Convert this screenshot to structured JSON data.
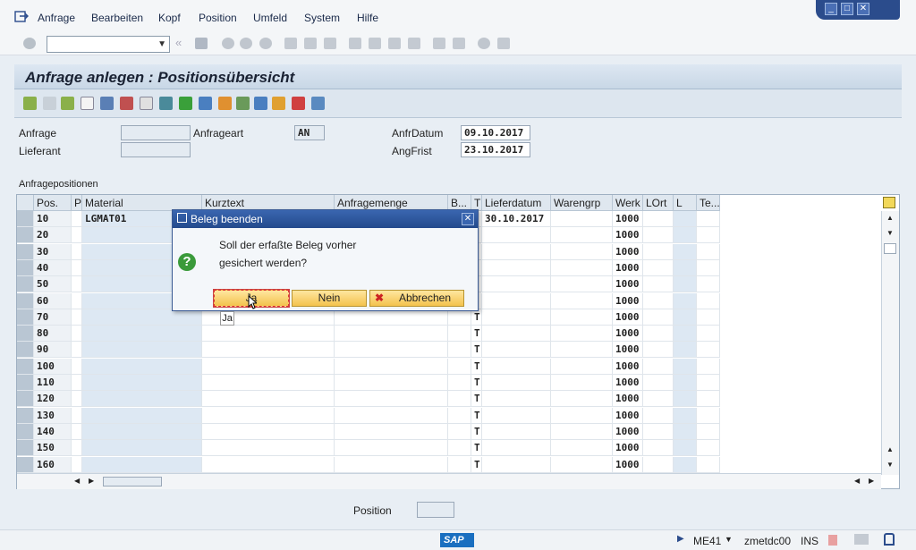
{
  "menu": [
    "Anfrage",
    "Bearbeiten",
    "Kopf",
    "Position",
    "Umfeld",
    "System",
    "Hilfe"
  ],
  "menu_accel": [
    "A",
    "B",
    "K",
    "P",
    "U",
    "S",
    "H"
  ],
  "window_controls": [
    "minimize-icon",
    "maximize-icon",
    "close-icon"
  ],
  "page_title": "Anfrage anlegen : Positionsübersicht",
  "header": {
    "anfrage_label": "Anfrage",
    "anfrage_value": "",
    "lieferant_label": "Lieferant",
    "lieferant_value": "",
    "anfrageart_label": "Anfrageart",
    "anfrageart_value": "AN",
    "anfrdatum_label": "AnfrDatum",
    "anfrdatum_value": "09.10.2017",
    "angfrist_label": "AngFrist",
    "angfrist_value": "23.10.2017"
  },
  "table_title": "Anfragepositionen",
  "columns": [
    "Pos.",
    "P",
    "Material",
    "Kurztext",
    "Anfragemenge",
    "B...",
    "T",
    "Lieferdatum",
    "Warengrp",
    "Werk",
    "LOrt",
    "L",
    "Te..."
  ],
  "rows": [
    {
      "pos": "10",
      "material": "LGMAT01",
      "t": "",
      "lieferdatum": "30.10.2017",
      "werk": "1000"
    },
    {
      "pos": "20",
      "material": "",
      "t": "",
      "lieferdatum": "",
      "werk": "1000"
    },
    {
      "pos": "30",
      "material": "",
      "t": "",
      "lieferdatum": "",
      "werk": "1000"
    },
    {
      "pos": "40",
      "material": "",
      "t": "",
      "lieferdatum": "",
      "werk": "1000"
    },
    {
      "pos": "50",
      "material": "",
      "t": "",
      "lieferdatum": "",
      "werk": "1000"
    },
    {
      "pos": "60",
      "material": "",
      "t": "",
      "lieferdatum": "",
      "werk": "1000"
    },
    {
      "pos": "70",
      "material": "",
      "t": "T",
      "lieferdatum": "",
      "werk": "1000"
    },
    {
      "pos": "80",
      "material": "",
      "t": "T",
      "lieferdatum": "",
      "werk": "1000"
    },
    {
      "pos": "90",
      "material": "",
      "t": "T",
      "lieferdatum": "",
      "werk": "1000"
    },
    {
      "pos": "100",
      "material": "",
      "t": "T",
      "lieferdatum": "",
      "werk": "1000"
    },
    {
      "pos": "110",
      "material": "",
      "t": "T",
      "lieferdatum": "",
      "werk": "1000"
    },
    {
      "pos": "120",
      "material": "",
      "t": "T",
      "lieferdatum": "",
      "werk": "1000"
    },
    {
      "pos": "130",
      "material": "",
      "t": "T",
      "lieferdatum": "",
      "werk": "1000"
    },
    {
      "pos": "140",
      "material": "",
      "t": "T",
      "lieferdatum": "",
      "werk": "1000"
    },
    {
      "pos": "150",
      "material": "",
      "t": "T",
      "lieferdatum": "",
      "werk": "1000"
    },
    {
      "pos": "160",
      "material": "",
      "t": "T",
      "lieferdatum": "",
      "werk": "1000"
    }
  ],
  "dialog": {
    "title": "Beleg beenden",
    "line1": "Soll der erfaßte Beleg vorher",
    "line2": "gesichert werden?",
    "btn_yes": "Ja",
    "btn_no": "Nein",
    "btn_cancel": "Abbrechen",
    "tooltip": "Ja"
  },
  "footer": {
    "position_label": "Position"
  },
  "status": {
    "transaction": "ME41",
    "server": "zmetdc00",
    "mode": "INS",
    "logo": "SAP"
  },
  "colors": {
    "accent": "#2b4c8c",
    "button": "#f3c34d",
    "question": "#3a9a3a",
    "cancel": "#cc2222"
  }
}
